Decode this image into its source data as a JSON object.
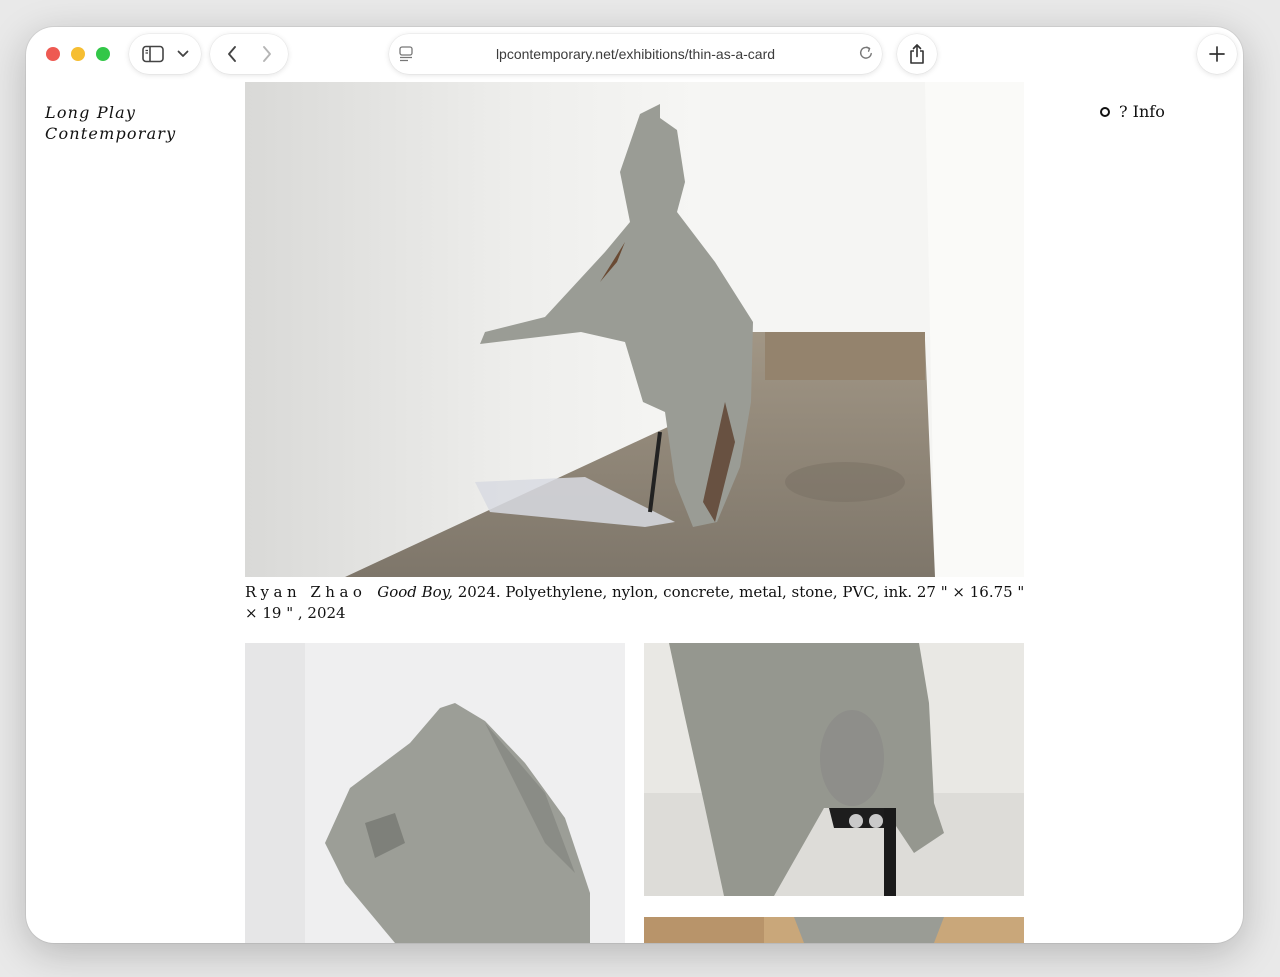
{
  "browser": {
    "url": "lpcontemporary.net/exhibitions/thin-as-a-card",
    "icons": {
      "sidebar": "sidebar-icon",
      "tab_menu": "chevron-down-icon",
      "back": "chevron-left-icon",
      "forward": "chevron-right-icon",
      "reader": "reader-icon",
      "reload": "reload-icon",
      "share": "share-icon",
      "new_tab": "plus-icon"
    }
  },
  "site": {
    "title_line1": "Long Play",
    "title_line2": "Contemporary",
    "info_label": "? Info"
  },
  "artwork": {
    "artist": "Ryan Zhao",
    "title": "Good Boy,",
    "details": "2024. Polyethylene, nylon, concrete, metal, stone, PVC, ink. 27 \" × 16.75 \" × 19 \" , 2024"
  },
  "colors": {
    "window_bg": "#ffffff",
    "text": "#111111",
    "concrete": "#9a9c95",
    "floor": "#8b8173"
  }
}
